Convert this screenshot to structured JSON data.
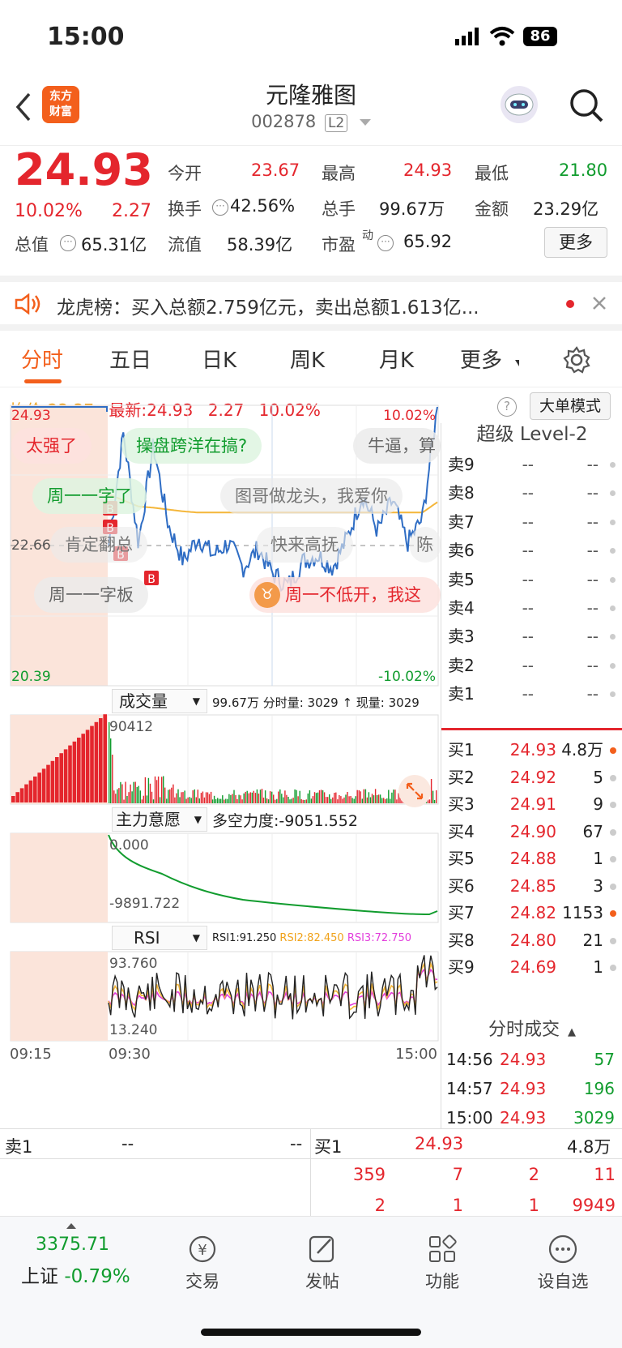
{
  "status": {
    "time": "15:00",
    "battery": "86"
  },
  "header": {
    "name": "元隆雅图",
    "code": "002878",
    "level": "L2",
    "logo_line1": "东方",
    "logo_line2": "财富"
  },
  "quote": {
    "price": "24.93",
    "pct": "10.02%",
    "chg": "2.27",
    "row1": [
      {
        "label": "今开",
        "value": "23.67",
        "color": "#e4262d"
      },
      {
        "label": "最高",
        "value": "24.93",
        "color": "#e4262d"
      },
      {
        "label": "最低",
        "value": "21.80",
        "color": "#119c2e"
      }
    ],
    "row2": [
      {
        "label": "换手",
        "value": "42.56%"
      },
      {
        "label": "总手",
        "value": "99.67万"
      },
      {
        "label": "金额",
        "value": "23.29亿"
      }
    ],
    "row3": [
      {
        "label": "总值",
        "value": "65.31亿"
      },
      {
        "label": "流值",
        "value": "58.39亿"
      },
      {
        "label": "市盈",
        "sup": "动",
        "value": "65.92"
      }
    ],
    "more": "更多"
  },
  "news": {
    "text": "龙虎榜：买入总额2.759亿元，卖出总额1.613亿..."
  },
  "tabs": [
    "分时",
    "五日",
    "日K",
    "周K",
    "月K",
    "更多"
  ],
  "info": {
    "avg_label": "均价:",
    "avg": "23.37",
    "last_label": "最新:",
    "last": "24.93",
    "chg": "2.27",
    "pct": "10.02%",
    "mode": "大单模式"
  },
  "chart_labels": {
    "high": "24.93",
    "mid": "22.66",
    "low": "20.39",
    "pct_high": "10.02%",
    "pct_low": "-10.02%",
    "vol_menu": "成交量",
    "vol_info": "99.67万 分时量: 3029 ↑ 现量: 3029",
    "vol_max": "90412",
    "main_menu": "主力意愿",
    "main_info": "多空力度:-9051.552",
    "main_top": "0.000",
    "main_bottom": "-9891.722",
    "rsi_menu": "RSI",
    "rsi1": "RSI1:91.250",
    "rsi2": "RSI2:82.450",
    "rsi3": "RSI3:72.750",
    "rsi_top": "93.760",
    "rsi_bottom": "13.240",
    "t0": "09:15",
    "t1": "09:30",
    "t2": "15:00"
  },
  "danmaku": [
    "太强了",
    "操盘跨洋在搞?",
    "牛逼，算",
    "周一一字了",
    "图哥做龙头，我爱你",
    "肯定翻总",
    "快来高抚",
    "陈",
    "周一一字板",
    "周一不低开，我这"
  ],
  "chart_data": {
    "type": "line",
    "title": "元隆雅图 分时",
    "x": [
      "09:30",
      "15:00"
    ],
    "ylim": [
      20.39,
      24.93
    ],
    "prev_close": 22.66,
    "series": [
      {
        "name": "最新",
        "values": [
          22.66,
          24.5,
          22.7,
          24.3,
          23.0,
          22.4,
          22.8,
          22.5,
          22.7,
          22.3,
          22.6,
          22.2,
          22.0,
          22.4,
          22.5,
          22.3,
          22.8,
          23.5,
          22.9,
          23.4,
          22.7,
          23.1,
          24.93
        ]
      },
      {
        "name": "均价",
        "values": [
          23.5,
          23.4,
          23.3,
          23.28,
          23.25,
          23.22,
          23.2,
          23.2,
          23.2,
          23.2,
          23.2,
          23.2,
          23.2,
          23.2,
          23.2,
          23.2,
          23.2,
          23.2,
          23.2,
          23.2,
          23.2,
          23.2,
          23.37
        ]
      }
    ]
  },
  "orderbook": {
    "title": "超级 Level-2",
    "asks": [
      {
        "l": "卖9",
        "p": "--",
        "v": "--"
      },
      {
        "l": "卖8",
        "p": "--",
        "v": "--"
      },
      {
        "l": "卖7",
        "p": "--",
        "v": "--"
      },
      {
        "l": "卖6",
        "p": "--",
        "v": "--"
      },
      {
        "l": "卖5",
        "p": "--",
        "v": "--"
      },
      {
        "l": "卖4",
        "p": "--",
        "v": "--"
      },
      {
        "l": "卖3",
        "p": "--",
        "v": "--"
      },
      {
        "l": "卖2",
        "p": "--",
        "v": "--"
      },
      {
        "l": "卖1",
        "p": "--",
        "v": "--"
      }
    ],
    "bids": [
      {
        "l": "买1",
        "p": "24.93",
        "v": "4.8万"
      },
      {
        "l": "买2",
        "p": "24.92",
        "v": "5"
      },
      {
        "l": "买3",
        "p": "24.91",
        "v": "9"
      },
      {
        "l": "买4",
        "p": "24.90",
        "v": "67"
      },
      {
        "l": "买5",
        "p": "24.88",
        "v": "1"
      },
      {
        "l": "买6",
        "p": "24.85",
        "v": "3"
      },
      {
        "l": "买7",
        "p": "24.82",
        "v": "1153"
      },
      {
        "l": "买8",
        "p": "24.80",
        "v": "21"
      },
      {
        "l": "买9",
        "p": "24.69",
        "v": "1"
      }
    ]
  },
  "trades": {
    "title": "分时成交",
    "rows": [
      {
        "t": "14:56",
        "p": "24.93",
        "v": "57"
      },
      {
        "t": "14:57",
        "p": "24.93",
        "v": "196"
      },
      {
        "t": "15:00",
        "p": "24.93",
        "v": "3029"
      }
    ]
  },
  "bottom": {
    "sell_label": "卖1",
    "sell_p": "--",
    "sell_v": "--",
    "buy_label": "买1",
    "buy_p": "24.93",
    "buy_v": "4.8万",
    "row1": [
      "359",
      "7",
      "2",
      "11"
    ],
    "row2": [
      "2",
      "1",
      "1",
      "9949"
    ]
  },
  "tabbar": {
    "index_value": "3375.71",
    "index_name": "上证",
    "index_pct": "-0.79%",
    "items": [
      "交易",
      "发帖",
      "功能",
      "设自选"
    ]
  }
}
